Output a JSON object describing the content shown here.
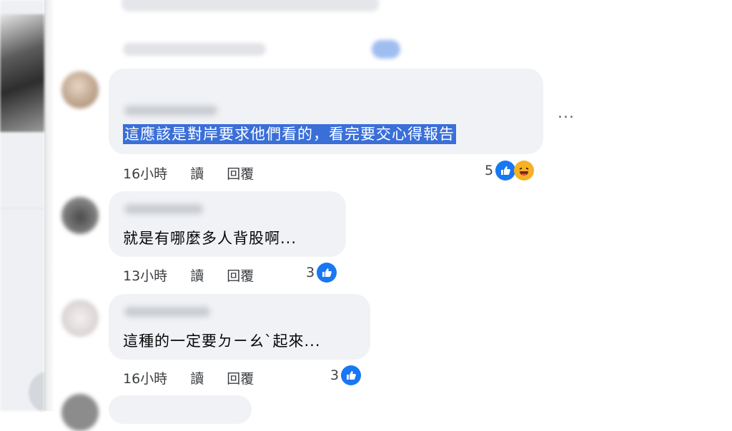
{
  "comments": [
    {
      "text": "這應該是對岸要求他們看的，看完要交心得報告",
      "time": "16小時",
      "read": "讀",
      "reply": "回覆",
      "reaction_count": "5"
    },
    {
      "text": "就是有哪麼多人背股啊...",
      "time": "13小時",
      "read": "讀",
      "reply": "回覆",
      "reaction_count": "3"
    },
    {
      "text": "這種的一定要ㄉㄧㄠˋ起來...",
      "time": "16小時",
      "read": "讀",
      "reply": "回覆",
      "reaction_count": "3"
    }
  ],
  "more_options": "...",
  "colors": {
    "like": "#1877f2",
    "haha": "#f7b125",
    "highlight": "#3a6fd8",
    "bubble": "#f0f2f5"
  },
  "icons": [
    "like-icon",
    "haha-icon",
    "more-options-icon"
  ]
}
